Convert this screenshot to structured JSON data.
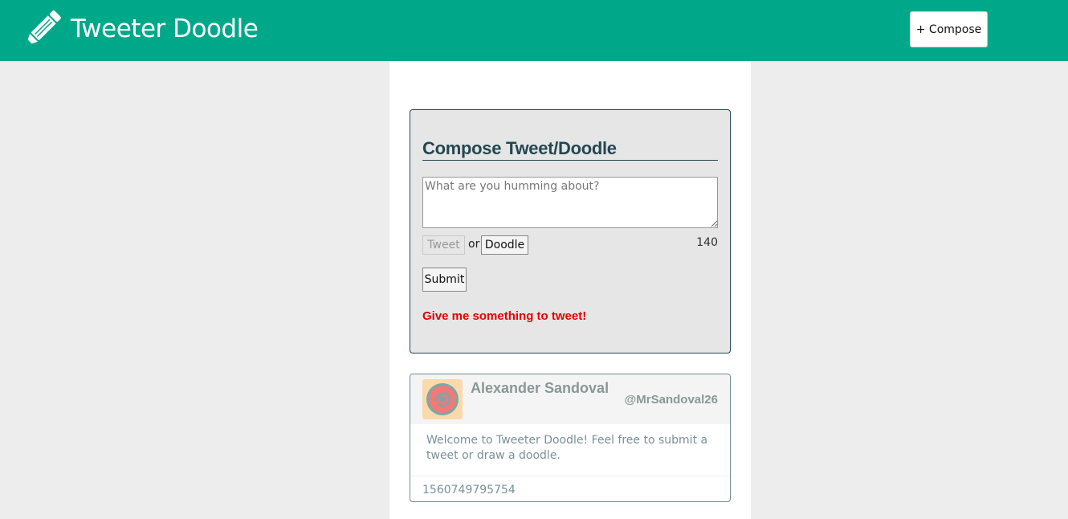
{
  "header": {
    "logo_icon": "pencil-icon",
    "title": "Tweeter Doodle",
    "compose_button": "+ Compose"
  },
  "composer": {
    "title": "Compose Tweet/Doodle",
    "textarea_placeholder": "What are you humming about?",
    "textarea_value": "",
    "mode_tweet": "Tweet",
    "mode_or": "or",
    "mode_doodle": "Doodle",
    "char_count": "140",
    "submit_label": "Submit",
    "error_message": "Give me something to tweet!"
  },
  "tweets": [
    {
      "avatar_icon": "avatar-icon",
      "name": "Alexander Sandoval",
      "handle": "@MrSandoval26",
      "content": "Welcome to Tweeter Doodle! Feel free to submit a tweet or draw a doodle.",
      "timestamp": "1560749795754"
    }
  ],
  "colors": {
    "navbar": "#00a88a",
    "page_background": "#ededed",
    "composer_background": "#e6e6e6",
    "accent_dark": "#244751",
    "error": "#e80000",
    "muted_text": "#7a9097",
    "avatar_background": "#fbd9aa",
    "avatar_circle": "#f07a78",
    "avatar_ring": "#7aa7a8"
  }
}
